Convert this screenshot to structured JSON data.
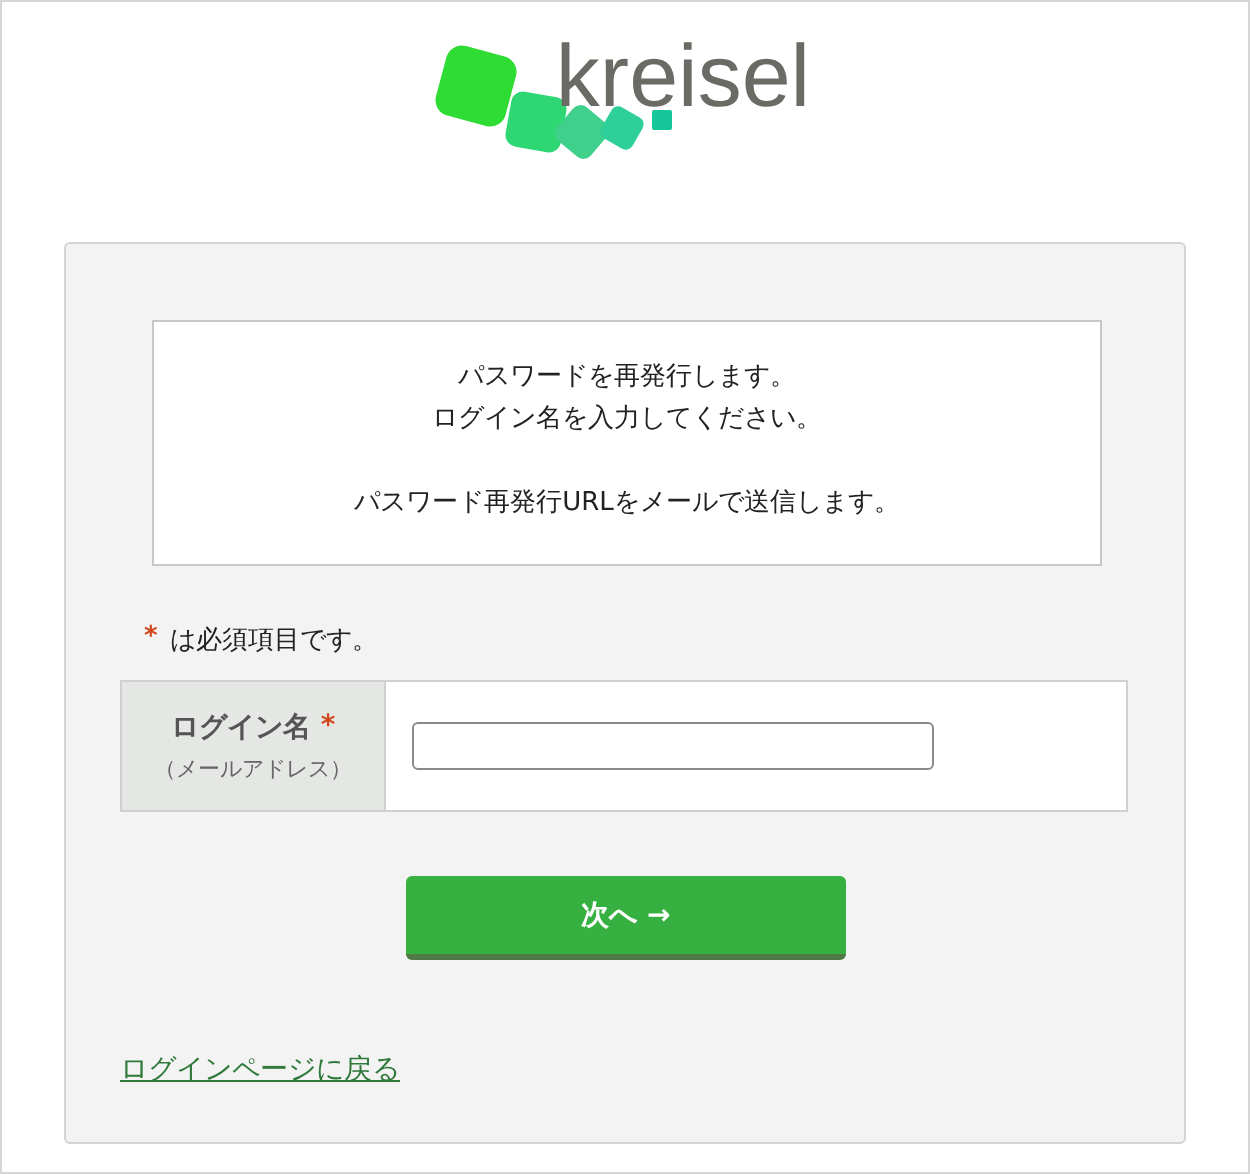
{
  "logo": {
    "text": "kreisel"
  },
  "info": {
    "lines": [
      "パスワードを再発行します。",
      "ログイン名を入力してください。",
      "パスワード再発行URLをメールで送信します。"
    ]
  },
  "required_note": {
    "mark": "*",
    "text": "は必須項目です。"
  },
  "field": {
    "label": "ログイン名",
    "required_mark": "*",
    "sublabel": "（メールアドレス）"
  },
  "button": "次へ →",
  "back_link": "ログインページに戻る"
}
